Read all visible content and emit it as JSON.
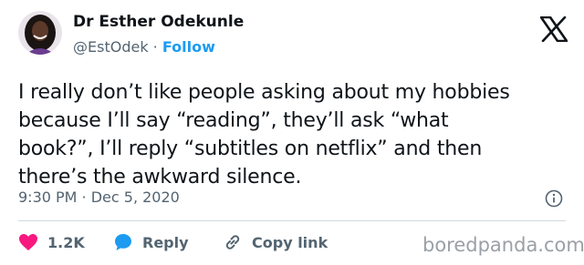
{
  "author": {
    "name": "Dr Esther Odekunle",
    "handle": "@EstOdek",
    "separator": "·",
    "follow_label": "Follow"
  },
  "tweet": {
    "text": "I really don’t like people asking about my hobbies\nbecause I’ll say “reading”, they’ll ask “what\nbook?”, I’ll reply “subtitles on netflix” and then\nthere’s the awkward silence.",
    "timestamp": "9:30 PM · Dec 5, 2020"
  },
  "actions": {
    "like_count": "1.2K",
    "reply_label": "Reply",
    "copy_label": "Copy link"
  },
  "watermark": "boredpanda.com",
  "colors": {
    "like": "#f91880",
    "reply": "#1d9bf0",
    "follow": "#1d9bf0",
    "muted": "#536471",
    "text": "#0f1419"
  },
  "icons": [
    "x-logo-icon",
    "info-icon",
    "heart-icon",
    "chat-bubble-icon",
    "link-icon"
  ]
}
